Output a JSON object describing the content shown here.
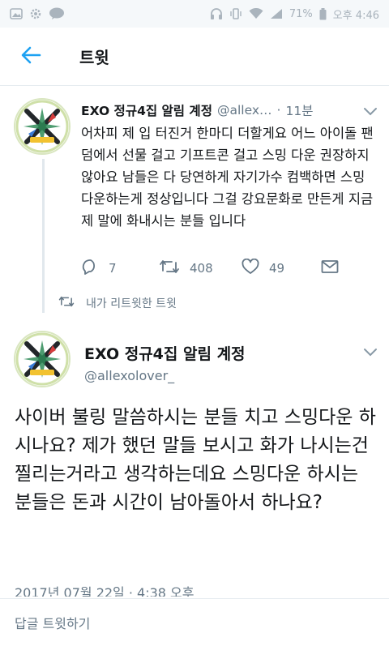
{
  "status_bar": {
    "battery": "71%",
    "time": "오후 4:46",
    "icons": [
      "photo-icon",
      "settings-icon",
      "talk-icon",
      "headphone-icon",
      "vibrate-icon",
      "wifi-icon",
      "signal-icon",
      "battery-icon"
    ]
  },
  "app_bar": {
    "title": "트윗",
    "back_icon": "arrow-left-icon"
  },
  "quoted_tweet": {
    "name": "EXO 정규4집 알림 계정",
    "handle": "@allex",
    "handle_ellipsis": "…",
    "separator": "·",
    "time": "11분",
    "text": "어차피 제 입 터진거 한마디 더할게요 어느 아이돌 팬덤에서 선물 걸고 기프트콘 걸고 스밍 다운 권장하지 않아요 남들은 다 당연하게 자기가수 컴백하면 스밍 다운하는게 정상입니다 그걸 강요문화로 만든게 지금 제 말에 화내시는 분들 입니다",
    "reply_count": "7",
    "retweet_count": "408",
    "like_count": "49"
  },
  "retweet_note": "내가 리트윗한 트윗",
  "main_tweet": {
    "name": "EXO 정규4집 알림 계정",
    "handle": "@allexolover_",
    "text": "사이버 불링 말씀하시는 분들 치고 스밍다운 하시나요? 제가 했던 말들 보시고 화가 나시는건 찔리는거라고 생각하는데요 스밍다운 하시는 분들은 돈과 시간이 남아돌아서 하나요?",
    "date": "2017년 07월 22일 · 4:38 오후"
  },
  "reply_bar": {
    "placeholder": "답글 트윗하기"
  },
  "colors": {
    "accent": "#1da1f2",
    "text_primary": "#14171a",
    "text_secondary": "#657786",
    "divider": "#e6ecf0"
  }
}
